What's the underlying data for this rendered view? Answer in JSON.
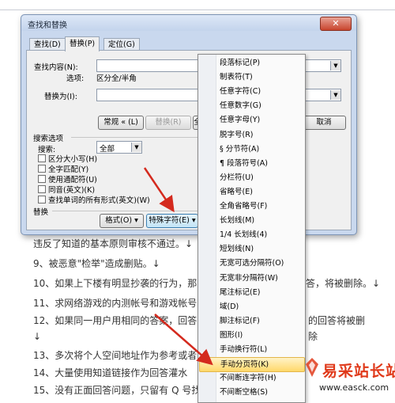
{
  "dialog": {
    "title": "查找和替换",
    "tabs": [
      "查找(D)",
      "替换(P)",
      "定位(G)"
    ],
    "find_label": "查找内容(N):",
    "options_label": "选项:",
    "options_value": "区分全/半角",
    "replace_label": "替换为(I):",
    "buttons": {
      "less": "常规 « (L)",
      "replace": "替换(R)",
      "replace_all_partial": "全",
      "cancel": "取消"
    },
    "search_options_title": "搜索选项",
    "search_label": "搜索:",
    "search_value": "全部",
    "checkboxes": [
      "区分大小写(H)",
      "全字匹配(Y)",
      "使用通配符(U)",
      "同音(英文)(K)",
      "查找单词的所有形式(英文)(W)"
    ],
    "replace_section_title": "替换",
    "format_button": "格式(O) ▾",
    "special_button": "特殊字符(E) ▾",
    "close_glyph": "✕"
  },
  "menu": {
    "items": [
      "段落标记(P)",
      "制表符(T)",
      "任意字符(C)",
      "任意数字(G)",
      "任意字母(Y)",
      "脱字号(R)",
      "§ 分节符(A)",
      "¶ 段落符号(A)",
      "分栏符(U)",
      "省略号(E)",
      "全角省略号(F)",
      "长划线(M)",
      "1/4 长划线(4)",
      "短划线(N)",
      "无宽可选分隔符(O)",
      "无宽非分隔符(W)",
      "尾注标记(E)",
      "域(D)",
      "脚注标记(F)",
      "图形(I)",
      "手动换行符(L)",
      "手动分页符(K)",
      "不间断连字符(H)",
      "不间断空格(S)"
    ],
    "highlighted_index": 21
  },
  "document": {
    "lines": [
      "违反了知道的基本原则审核不通过。↓",
      "9、被恶意\"检举\"造成删贴。↓",
      "10、如果上下楼有明显抄袭的行为，那",
      "11、求网络游戏的内测帐号和游戏帐号",
      "12、如果同一用户用相同的答案，回答",
      "↓",
      "13、多次将个人空间地址作为参考或者",
      "14、大量使用知道链接作为回答灌水",
      "15、没有正面回答问题，只留有 Q 号找"
    ],
    "right_fragments": [
      "答，将被删除。↓",
      "的回答将被删",
      "除"
    ]
  },
  "watermark": {
    "text": "易采站长站",
    "url": "www.easck.com"
  },
  "colors": {
    "arrow": "#d42a1e",
    "highlight": "#ffd86a",
    "watermark": "#e0391a"
  }
}
